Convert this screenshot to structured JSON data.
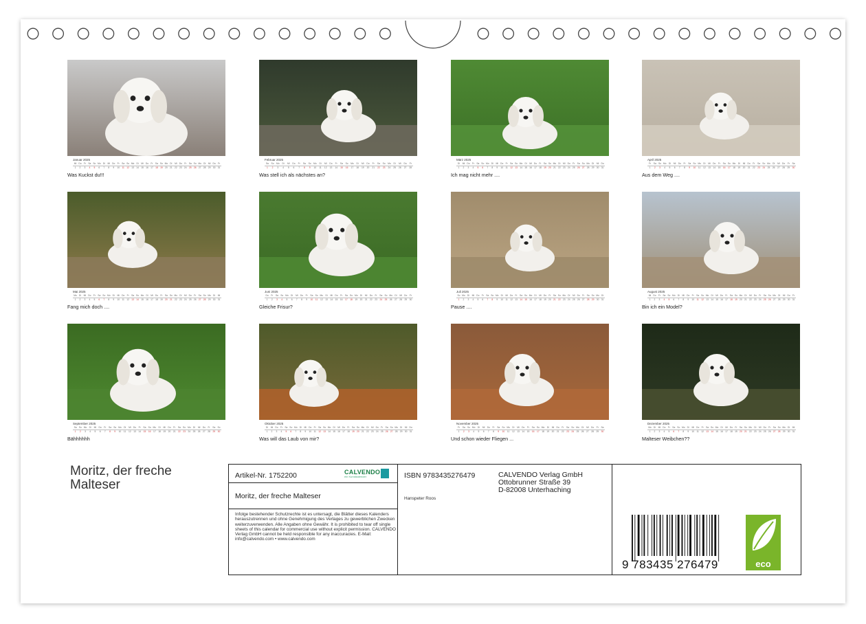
{
  "months": [
    {
      "label": "Januar 2025",
      "caption": "Was Kuckst du!!!",
      "days": 31
    },
    {
      "label": "Februar 2025",
      "caption": "Was stell ich als nächstes an?",
      "days": 28
    },
    {
      "label": "März 2025",
      "caption": "Ich mag nicht mehr ....",
      "days": 31
    },
    {
      "label": "April 2025",
      "caption": "Aus dem Weg ....",
      "days": 30
    },
    {
      "label": "Mai 2025",
      "caption": "Fang mich doch ....",
      "days": 31
    },
    {
      "label": "Juni 2025",
      "caption": "Gleiche Frisur?",
      "days": 30
    },
    {
      "label": "Juli 2025",
      "caption": "Pause ....",
      "days": 31
    },
    {
      "label": "August 2025",
      "caption": "Bin ich ein Model?",
      "days": 31
    },
    {
      "label": "September 2025",
      "caption": "Bähhhhhh",
      "days": 30
    },
    {
      "label": "Oktober 2025",
      "caption": "Was will das Laub von mir?",
      "days": 31
    },
    {
      "label": "November 2025",
      "caption": "Und schon wieder Fliegen ...",
      "days": 30
    },
    {
      "label": "Dezember 2025",
      "caption": "Malteser Weibchen??",
      "days": 31
    }
  ],
  "title": "Moritz, der freche Malteser",
  "info": {
    "article_no": "Artikel-Nr. 1752200",
    "brand": "CALVENDO",
    "brand_sub": "ein Kunstkalender",
    "title": "Moritz, der freche Malteser",
    "legal": "Infolge bestehender Schutzrechte ist es untersagt, die Blätter dieses Kalenders herauszutrennen und ohne Genehmigung des Verlages zu gewerblichen Zwecken weiterzuverwenden. Alle Angaben ohne Gewähr. It is prohibited to tear off single sheets of this calendar for commercial use without explicit permission. CALVENDO Verlag GmbH cannot be held responsible for any inaccuracies. E-Mail: info@calvendo.com • www.calvendo.com",
    "isbn": "ISBN 9783435276479",
    "author": "Hanspeter Roos",
    "publisher_name": "CALVENDO Verlag GmbH",
    "publisher_street": "Ottobrunner Straße 39",
    "publisher_city": "D-82008 Unterhaching",
    "barcode_digits": "9 783435 276479",
    "eco_label": "eco"
  },
  "colors": {
    "accent": "#7ab52a",
    "brand": "#1b7f46",
    "weekend": "#cc3333"
  },
  "binding_holes": 30
}
